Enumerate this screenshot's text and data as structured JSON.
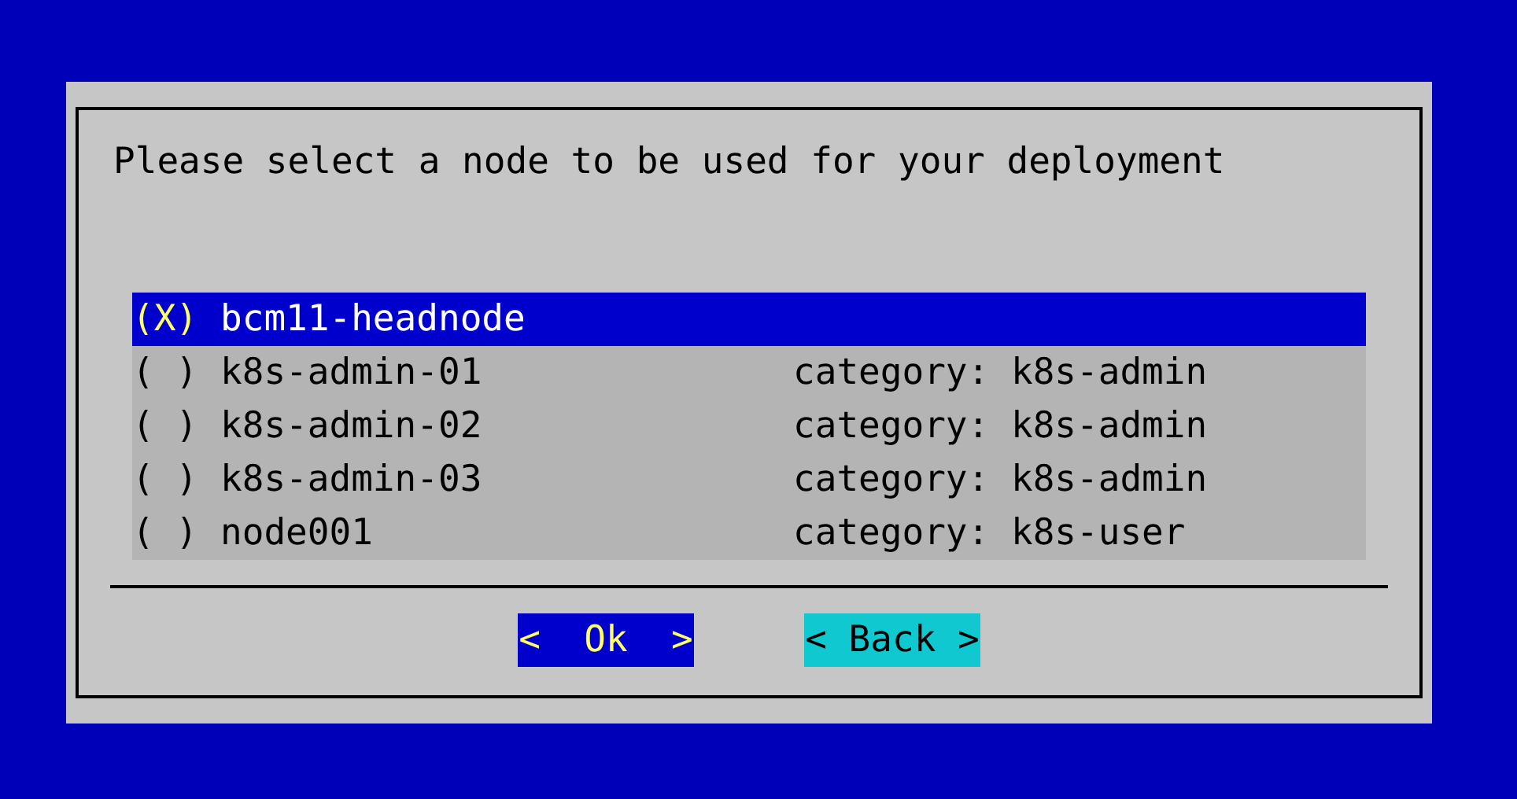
{
  "dialog": {
    "prompt": "Please select a node to be used for your deployment",
    "items": [
      {
        "marker": "(X)",
        "name": "bcm11-headnode",
        "selected": true
      },
      {
        "marker": "( )",
        "name": "k8s-admin-01",
        "category": "category: k8s-admin",
        "selected": false
      },
      {
        "marker": "( )",
        "name": "k8s-admin-02",
        "category": "category: k8s-admin",
        "selected": false
      },
      {
        "marker": "( )",
        "name": "k8s-admin-03",
        "category": "category: k8s-admin",
        "selected": false
      },
      {
        "marker": "( )",
        "name": "node001",
        "category": "category: k8s-user",
        "selected": false
      }
    ],
    "buttons": [
      {
        "label": "<  Ok  >",
        "selected": true
      },
      {
        "label": "< Back >",
        "selected": false
      }
    ]
  }
}
